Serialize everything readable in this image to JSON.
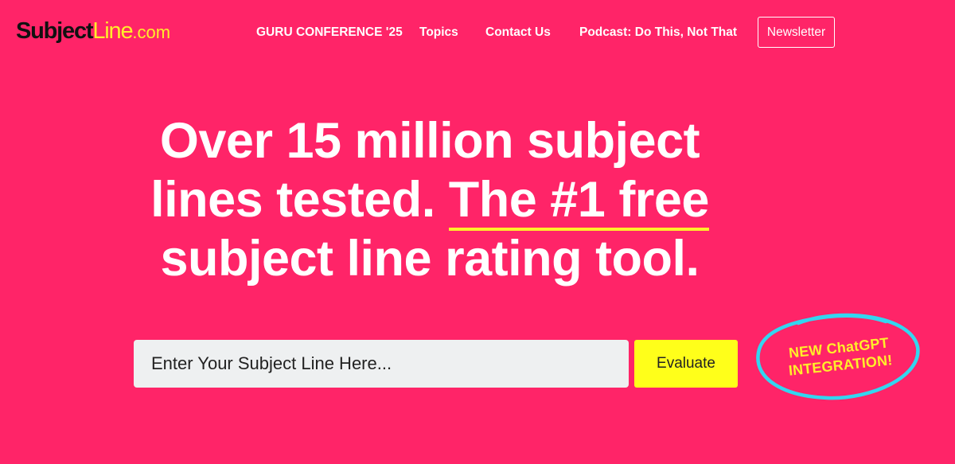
{
  "logo": {
    "part1": "Subject",
    "part2": "Line",
    "part3": ".com"
  },
  "nav": {
    "items": [
      {
        "label": "GURU CONFERENCE '25"
      },
      {
        "label": "Topics"
      },
      {
        "label": "Contact Us"
      },
      {
        "label": "Podcast: Do This, Not That"
      }
    ],
    "newsletter_label": "Newsletter"
  },
  "hero": {
    "headline_part1": "Over 15 million subject lines tested.",
    "headline_highlight": "The #1 free",
    "headline_part2": "subject line rating tool."
  },
  "form": {
    "input_placeholder": "Enter Your Subject Line Here...",
    "input_value": "",
    "evaluate_label": "Evaluate"
  },
  "promo": {
    "line1": "NEW ChatGPT",
    "line2": "INTEGRATION!"
  },
  "colors": {
    "background": "#ff2468",
    "accent_yellow": "#ffee2a",
    "button_yellow": "#ffff1a",
    "circle_cyan": "#33d6f0"
  }
}
